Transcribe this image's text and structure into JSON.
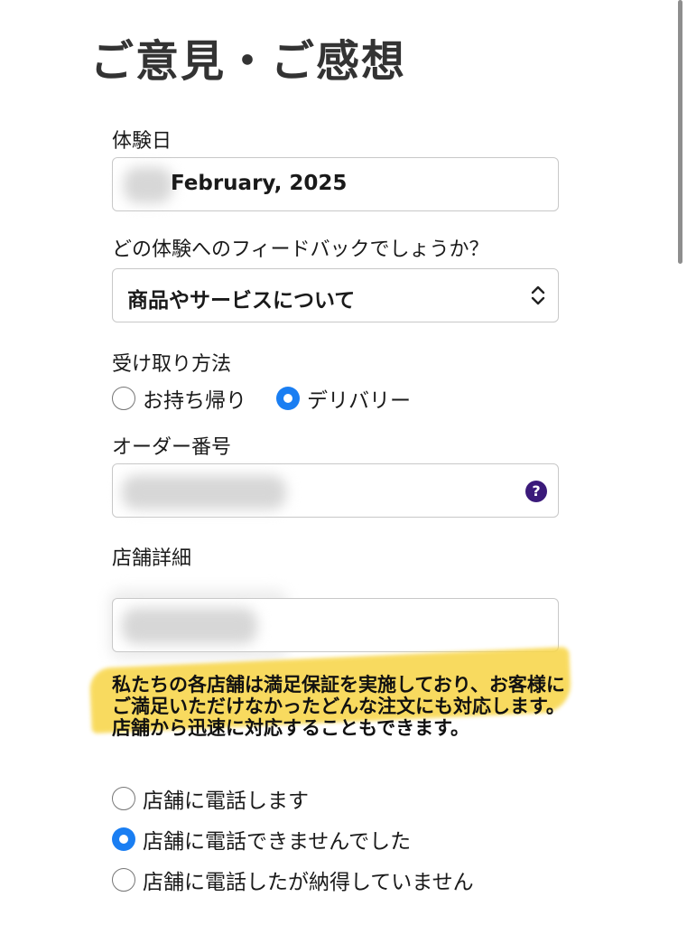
{
  "page_title": "ご意見・ご感想",
  "experience_date": {
    "label": "体験日",
    "value": "February, 2025"
  },
  "feedback_type": {
    "label": "どの体験へのフィードバックでしょうか？",
    "selected": "商品やサービスについて"
  },
  "pickup_method": {
    "label": "受け取り方法",
    "options": [
      {
        "label": "お持ち帰り",
        "checked": false
      },
      {
        "label": "デリバリー",
        "checked": true
      }
    ]
  },
  "order_number": {
    "label": "オーダー番号",
    "help_glyph": "?"
  },
  "store_details": {
    "label": "店舗詳細"
  },
  "notice": "私たちの各店舗は満足保証を実施しており、お客様にご満足いただけなかったどんな注文にも対応します。店舗から迅速に対応することもできます。",
  "contact_options": [
    {
      "label": "店舗に電話します",
      "checked": false
    },
    {
      "label": "店舗に電話できませんでした",
      "checked": true
    },
    {
      "label": "店舗に電話したが納得していません",
      "checked": false
    }
  ],
  "colors": {
    "accent": "#1a7ef2",
    "highlight": "#f8d64a",
    "help_icon": "#3b1a7a"
  }
}
